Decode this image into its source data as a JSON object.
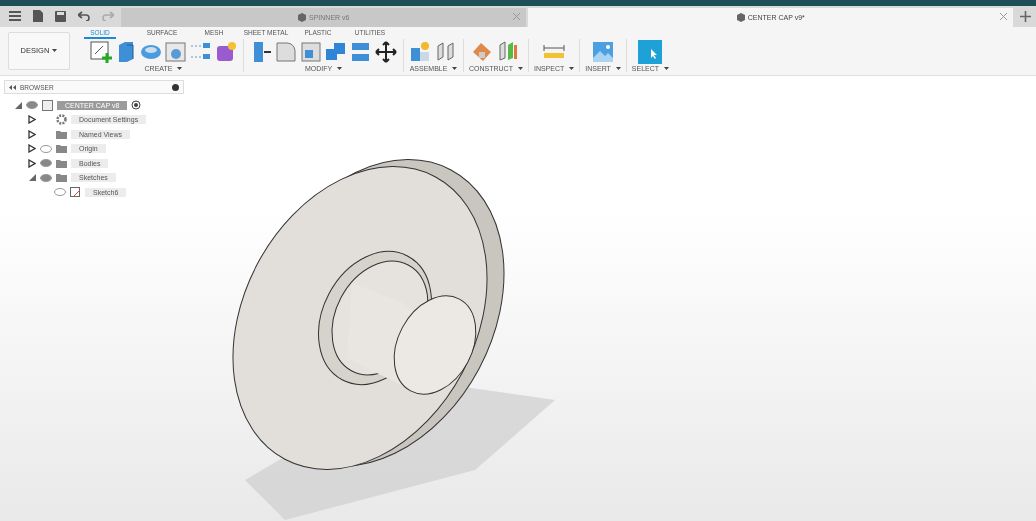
{
  "tabs": [
    {
      "label": "SPINNER v6",
      "selected": false
    },
    {
      "label": "CENTER CAP v9*",
      "selected": true
    }
  ],
  "workspace": {
    "label": "DESIGN"
  },
  "toolbar_tabs": [
    {
      "label": "SOLID",
      "selected": true
    },
    {
      "label": "SURFACE",
      "selected": false
    },
    {
      "label": "MESH",
      "selected": false
    },
    {
      "label": "SHEET METAL",
      "selected": false
    },
    {
      "label": "PLASTIC",
      "selected": false
    },
    {
      "label": "UTILITIES",
      "selected": false
    }
  ],
  "tool_groups": [
    {
      "label": "CREATE"
    },
    {
      "label": "MODIFY"
    },
    {
      "label": "ASSEMBLE"
    },
    {
      "label": "CONSTRUCT"
    },
    {
      "label": "INSPECT"
    },
    {
      "label": "INSERT"
    },
    {
      "label": "SELECT"
    }
  ],
  "browser": {
    "title": "BROWSER",
    "tree": [
      {
        "label": "CENTER CAP v8",
        "kind": "component",
        "visible": true,
        "expanded": true,
        "selected": true,
        "children": [
          {
            "label": "Document Settings",
            "kind": "settings",
            "expanded": false,
            "selected": false
          },
          {
            "label": "Named Views",
            "kind": "folder",
            "expanded": false,
            "selected": false
          },
          {
            "label": "Origin",
            "kind": "folder",
            "visible": false,
            "expanded": false,
            "selected": false
          },
          {
            "label": "Bodies",
            "kind": "folder",
            "visible": true,
            "expanded": false,
            "selected": false
          },
          {
            "label": "Sketches",
            "kind": "folder",
            "visible": true,
            "expanded": true,
            "selected": false,
            "children": [
              {
                "label": "Sketch6",
                "kind": "sketch",
                "visible": false,
                "selected": false
              }
            ]
          }
        ]
      }
    ]
  }
}
